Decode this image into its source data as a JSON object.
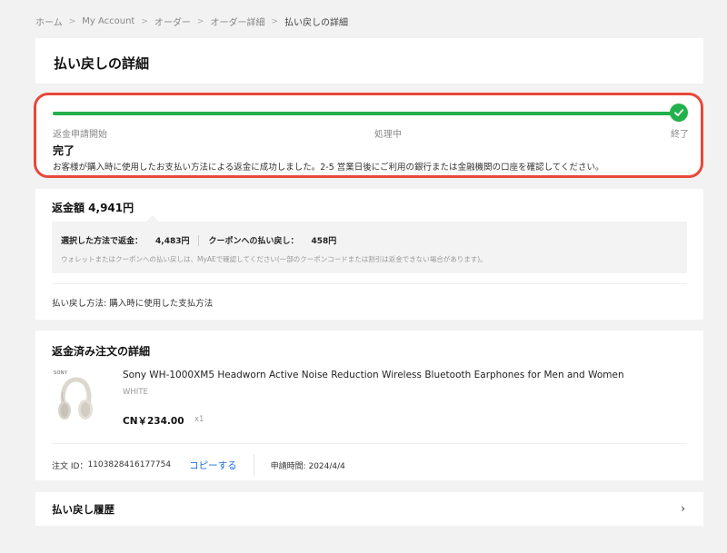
{
  "breadcrumb": {
    "items": [
      "ホーム",
      "My Account",
      "オーダー",
      "オーダー詳細",
      "払い戻しの詳細"
    ],
    "separator": ">"
  },
  "page_title": "払い戻しの詳細",
  "progress": {
    "steps": [
      "返金申請開始",
      "処理中",
      "終了"
    ],
    "completed_fraction": 1.0,
    "status_title": "完了",
    "status_desc": "お客様が購入時に使用したお支払い方法による返金に成功しました。2-5 営業日後にご利用の銀行または金融機関の口座を確認してください。",
    "colors": {
      "progress": "#23b14d",
      "highlight_border": "#e8483a"
    },
    "icon": "check-icon"
  },
  "refund_amount": {
    "title": "返金額 4,941円",
    "method_label": "選択した方法で返金：",
    "method_value": "4,483円",
    "coupon_label": "クーポンへの払い戻し：",
    "coupon_value": "458円",
    "note": "ウォレットまたはクーポンへの払い戻しは、MyAEで確認してください(一部のクーポンコードまたは割引は返金できない場合があります)。",
    "refund_method": "払い戻し方法: 購入時に使用した支払方法"
  },
  "order": {
    "title": "返金済み注文の詳細",
    "brand": "SONY",
    "product_name": "Sony WH-1000XM5 Headworn Active Noise Reduction Wireless Bluetooth Earphones for Men and Women",
    "variant": "WHITE",
    "price": "CN￥234.00",
    "quantity": "x1",
    "order_id_label": "注文 ID：",
    "order_id": "1103828416177754",
    "copy_label": "コピーする",
    "request_time": "申請時間: 2024/4/4",
    "colors": {
      "link": "#1a6fe0"
    }
  },
  "history": {
    "title": "払い戻し履歴",
    "chevron": "›",
    "icon": "chevron-right-icon"
  }
}
